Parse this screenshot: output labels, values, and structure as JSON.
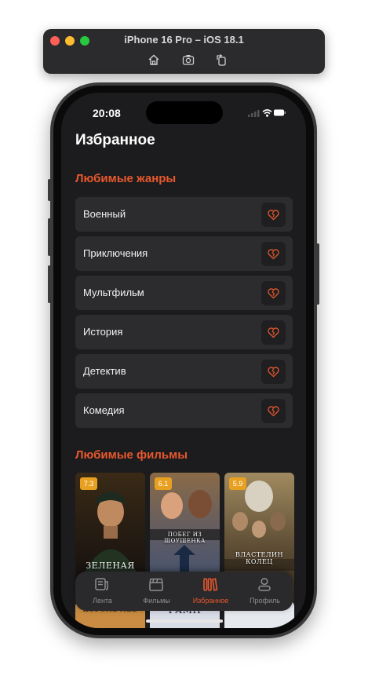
{
  "simulator": {
    "title": "iPhone 16 Pro – iOS 18.1",
    "tools": [
      "home-icon",
      "screenshot-icon",
      "rotate-icon"
    ]
  },
  "status_bar": {
    "time": "20:08"
  },
  "page_title": "Избранное",
  "genres": {
    "title": "Любимые жанры",
    "items": [
      {
        "label": "Военный"
      },
      {
        "label": "Приключения"
      },
      {
        "label": "Мультфильм"
      },
      {
        "label": "История"
      },
      {
        "label": "Детектив"
      },
      {
        "label": "Комедия"
      }
    ]
  },
  "films": {
    "title": "Любимые фильмы",
    "items": [
      {
        "rating": "7.3",
        "caption": "ЗЕЛЕНАЯ МИЛЯ",
        "colors": [
          "#1e2a1f",
          "#6b4a2a"
        ]
      },
      {
        "rating": "6.1",
        "caption": "ПОБЕГ ИЗ ШОУШЕНКА",
        "colors": [
          "#2e4a6b",
          "#c9a06b"
        ]
      },
      {
        "rating": "5.9",
        "caption": "ВЛАСТЕЛИН КОЛЕЦ",
        "colors": [
          "#6b5b3e",
          "#2a2418"
        ]
      }
    ],
    "second_row": [
      {
        "caption": "КОРОЛЬ ЛЕВ"
      },
      {
        "caption": "ГАМП"
      },
      {
        "caption": ""
      }
    ]
  },
  "tabbar": {
    "tabs": [
      {
        "label": "Лента",
        "icon": "feed-icon"
      },
      {
        "label": "Фильмы",
        "icon": "clapper-icon"
      },
      {
        "label": "Избранное",
        "icon": "favorites-icon",
        "active": true
      },
      {
        "label": "Профиль",
        "icon": "profile-icon"
      }
    ]
  },
  "colors": {
    "accent": "#e8582d",
    "rating_badge": "#e8a020"
  }
}
